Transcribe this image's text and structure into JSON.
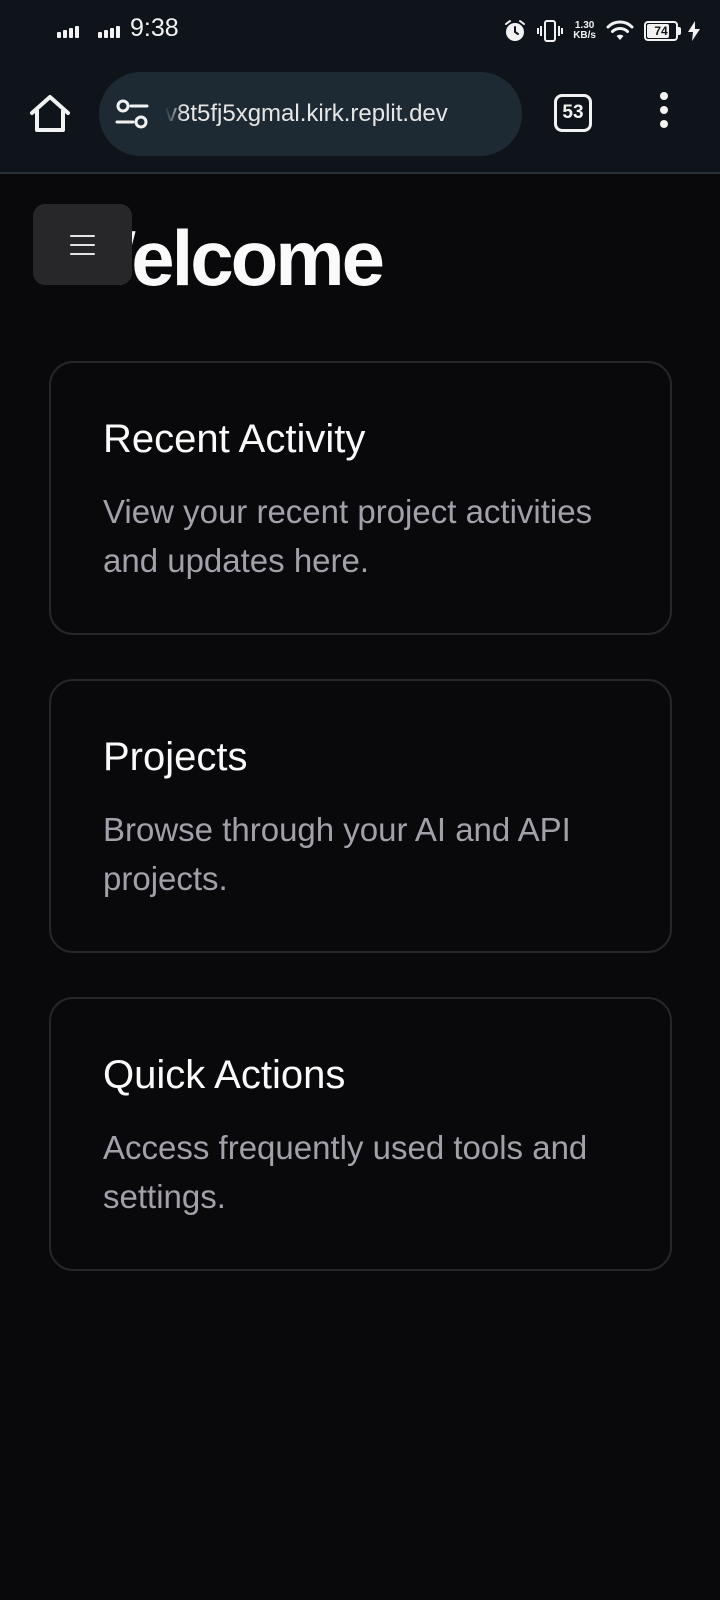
{
  "status_bar": {
    "time": "9:38",
    "network_speed_value": "1.30",
    "network_speed_unit": "KB/s",
    "battery_level": "74"
  },
  "browser": {
    "url": "v8t5fj5xgmal.kirk.replit.dev",
    "tab_count": "53"
  },
  "page": {
    "title": "Welcome",
    "cards": [
      {
        "title": "Recent Activity",
        "description": "View your recent project activities and updates here."
      },
      {
        "title": "Projects",
        "description": "Browse through your AI and API projects."
      },
      {
        "title": "Quick Actions",
        "description": "Access frequently used tools and settings."
      }
    ]
  },
  "colors": {
    "background": "#09090b",
    "card_border": "#27272a",
    "muted_text": "#a1a1aa",
    "toolbar": "#0f141b",
    "url_pill": "#1e2a33"
  },
  "icons": {
    "home": "home-icon",
    "site_settings": "tune-icon",
    "tabs": "tab-switcher-icon",
    "menu": "more-vert-icon",
    "sidebar_toggle": "hamburger-icon"
  }
}
